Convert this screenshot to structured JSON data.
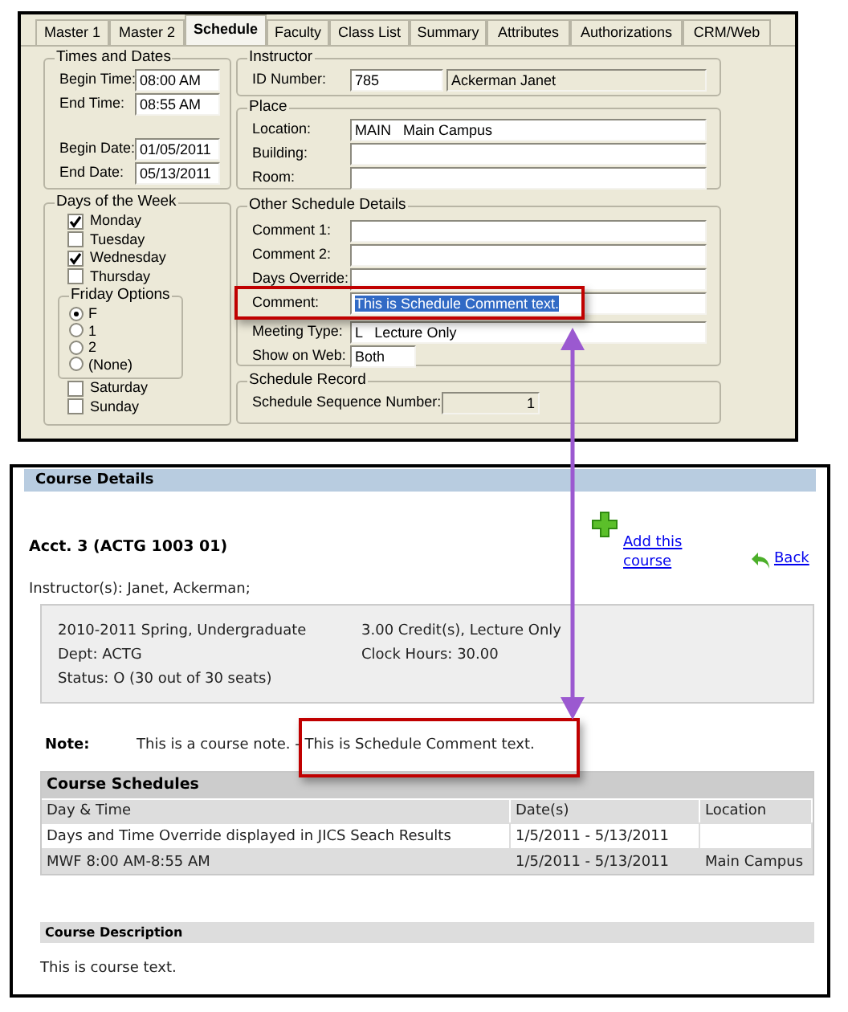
{
  "dialog": {
    "tabs": [
      {
        "label": "Master 1",
        "selected": false
      },
      {
        "label": "Master 2",
        "selected": false
      },
      {
        "label": "Schedule",
        "selected": true
      },
      {
        "label": "Faculty",
        "selected": false
      },
      {
        "label": "Class List",
        "selected": false
      },
      {
        "label": "Summary",
        "selected": false
      },
      {
        "label": "Attributes",
        "selected": false
      },
      {
        "label": "Authorizations",
        "selected": false
      },
      {
        "label": "CRM/Web",
        "selected": false
      }
    ],
    "times_and_dates": {
      "title": "Times and Dates",
      "times": [
        {
          "label": "Begin Time:",
          "value": "08:00 AM"
        },
        {
          "label": "End Time:",
          "value": "08:55 AM"
        }
      ],
      "dates": [
        {
          "label": "Begin Date:",
          "value": "01/05/2011"
        },
        {
          "label": "End Date:",
          "value": "05/13/2011"
        }
      ]
    },
    "days_of_week": {
      "title": "Days of the Week",
      "weekdays": [
        {
          "label": "Monday",
          "checked": true
        },
        {
          "label": "Tuesday",
          "checked": false
        },
        {
          "label": "Wednesday",
          "checked": true
        },
        {
          "label": "Thursday",
          "checked": false
        }
      ],
      "friday_options": {
        "title": "Friday Options",
        "options": [
          {
            "label": "F",
            "selected": true
          },
          {
            "label": "1",
            "selected": false
          },
          {
            "label": "2",
            "selected": false
          },
          {
            "label": "(None)",
            "selected": false
          }
        ]
      },
      "weekend": [
        {
          "label": "Saturday",
          "checked": false
        },
        {
          "label": "Sunday",
          "checked": false
        }
      ]
    },
    "instructor": {
      "title": "Instructor",
      "label": "ID Number:",
      "id_value": "785",
      "name_value": "Ackerman Janet"
    },
    "place": {
      "title": "Place",
      "fields": [
        {
          "label": "Location:",
          "value": "MAIN   Main Campus"
        },
        {
          "label": "Building:"
        },
        {
          "label": "Room:"
        }
      ]
    },
    "other_schedule_details": {
      "title": "Other Schedule Details",
      "fields": [
        {
          "label": "Comment 1:",
          "kind": "wide"
        },
        {
          "label": "Comment 2:",
          "kind": "wide"
        },
        {
          "label": "Days Override:",
          "kind": "wide"
        },
        {
          "label": "Comment:",
          "value": "This is Schedule Comment text.",
          "kind": "wide",
          "text_selected": true
        },
        {
          "label": "Meeting Type:",
          "value": "L   Lecture Only",
          "kind": "wide"
        },
        {
          "label": "Show on Web:",
          "value": "Both",
          "kind": "short"
        }
      ]
    },
    "schedule_record": {
      "title": "Schedule Record",
      "label": "Schedule Sequence Number:",
      "value": "1"
    }
  },
  "course_details": {
    "title": "Course Details",
    "course_title": "Acct. 3 (ACTG 1003 01)",
    "add_link": "Add this course",
    "back_link": "Back",
    "instructors": "Instructor(s): Janet, Ackerman;",
    "info_left": [
      "2010-2011 Spring, Undergraduate",
      "Dept: ACTG",
      "Status: O (30 out of 30 seats)"
    ],
    "info_right": [
      "3.00 Credit(s), Lecture Only",
      "Clock Hours: 30.00"
    ],
    "note_label": "Note:",
    "note_text": "This is a course note. - This is Schedule Comment text.",
    "schedules": {
      "title": "Course Schedules",
      "columns": [
        "Day & Time",
        "Date(s)",
        "Location"
      ],
      "rows": [
        [
          "Days and Time Override displayed in JICS Seach Results",
          "1/5/2011 - 5/13/2011",
          null
        ],
        [
          "MWF 8:00 AM-8:55 AM",
          "1/5/2011 - 5/13/2011",
          "Main Campus"
        ]
      ]
    },
    "description_heading": "Course Description",
    "description": "This is course text."
  }
}
